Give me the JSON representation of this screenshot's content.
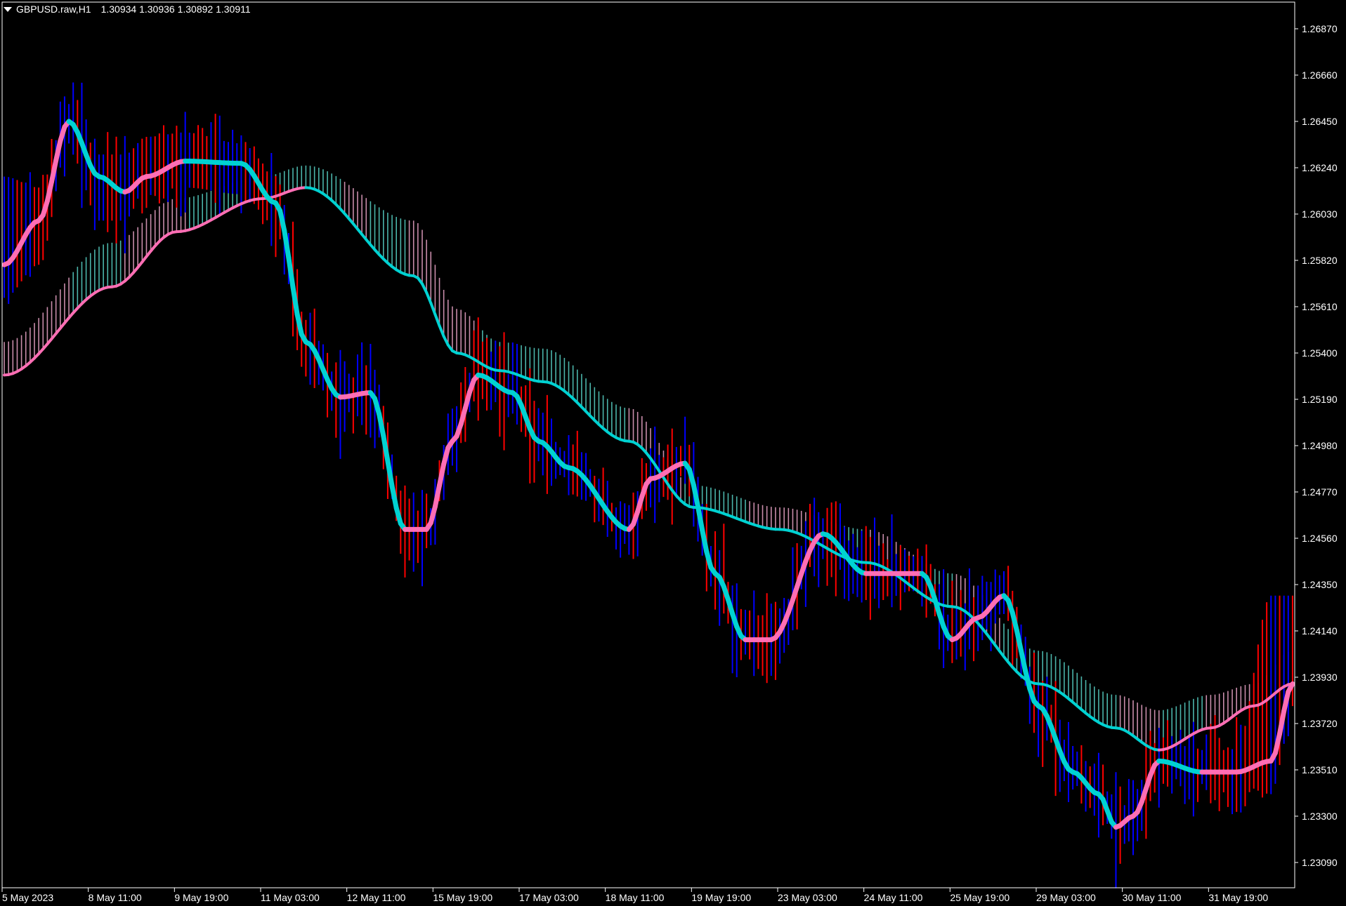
{
  "header": {
    "symbol": "GBPUSD.raw,H1",
    "quotes": "1.30934 1.30936 1.30892 1.30911"
  },
  "colors": {
    "background": "#000000",
    "axis": "#ffffff",
    "bull_candle": "#0000ff",
    "bear_candle": "#ff0000",
    "ma_down": "#00d2d2",
    "ma_up": "#ff6eb4",
    "band_down": "#4bb4aa",
    "band_up": "#c88caa"
  },
  "chart_data": {
    "type": "line",
    "title": "GBPUSD.raw,H1",
    "y_ticks": [
      "1.26870",
      "1.26660",
      "1.26450",
      "1.26240",
      "1.26030",
      "1.25820",
      "1.25610",
      "1.25400",
      "1.25190",
      "1.24980",
      "1.24770",
      "1.24560",
      "1.24350",
      "1.24140",
      "1.23930",
      "1.23720",
      "1.23510",
      "1.23300",
      "1.23090"
    ],
    "ylim": [
      1.2301,
      1.2696
    ],
    "x_ticks": [
      "5 May 2023",
      "8 May 11:00",
      "9 May 19:00",
      "11 May 03:00",
      "12 May 11:00",
      "15 May 19:00",
      "17 May 03:00",
      "18 May 11:00",
      "19 May 19:00",
      "23 May 03:00",
      "24 May 11:00",
      "25 May 19:00",
      "29 May 03:00",
      "30 May 11:00",
      "31 May 19:00"
    ],
    "bar_count": 300,
    "grid": false,
    "series": [
      {
        "kind": "fast_ma",
        "x": [
          0,
          8,
          15,
          22,
          28,
          33,
          42,
          55,
          63,
          70,
          78,
          85,
          93,
          98,
          104,
          110,
          118,
          124,
          131,
          145,
          150,
          158,
          165,
          172,
          178,
          190,
          200,
          213,
          220,
          226,
          232,
          240,
          248,
          254,
          258,
          262,
          268,
          278,
          286,
          294,
          299
        ],
        "values": [
          1.258,
          1.26,
          1.2645,
          1.262,
          1.2613,
          1.262,
          1.2627,
          1.2626,
          1.2608,
          1.2545,
          1.252,
          1.2522,
          1.246,
          1.246,
          1.25,
          1.253,
          1.2522,
          1.25,
          1.2488,
          1.246,
          1.2483,
          1.249,
          1.244,
          1.241,
          1.241,
          1.2458,
          1.244,
          1.244,
          1.241,
          1.242,
          1.243,
          1.238,
          1.235,
          1.234,
          1.2325,
          1.233,
          1.2355,
          1.235,
          1.235,
          1.2355,
          1.239
        ],
        "values_upper": [
          1.262,
          1.2615,
          1.2645,
          1.263,
          1.263,
          1.2638,
          1.264,
          1.2635,
          1.262,
          1.2555,
          1.2525,
          1.2535,
          1.2475,
          1.2465,
          1.251,
          1.2535,
          1.253,
          1.251,
          1.2493,
          1.2465,
          1.249,
          1.2495,
          1.245,
          1.2415,
          1.2415,
          1.2465,
          1.2445,
          1.2445,
          1.242,
          1.243,
          1.244,
          1.239,
          1.236,
          1.235,
          1.233,
          1.234,
          1.2365,
          1.236,
          1.236,
          1.243,
          1.243
        ],
        "values_low": [
          1.2565,
          1.258,
          1.2635,
          1.26,
          1.26,
          1.2618,
          1.2615,
          1.2612,
          1.2598,
          1.253,
          1.2516,
          1.2522,
          1.2455,
          1.2455,
          1.2497,
          1.2525,
          1.2515,
          1.2495,
          1.2483,
          1.2455,
          1.247,
          1.2485,
          1.2433,
          1.2405,
          1.2405,
          1.245,
          1.2432,
          1.2432,
          1.2405,
          1.2415,
          1.2425,
          1.2375,
          1.2345,
          1.233,
          1.2323,
          1.2325,
          1.235,
          1.2345,
          1.2345,
          1.234,
          1.2385
        ]
      },
      {
        "kind": "slow_ma",
        "x": [
          0,
          25,
          40,
          60,
          70,
          95,
          105,
          115,
          125,
          145,
          160,
          180,
          200,
          220,
          240,
          258,
          268,
          280,
          290,
          299
        ],
        "values": [
          1.253,
          1.257,
          1.2595,
          1.261,
          1.2615,
          1.2575,
          1.254,
          1.2532,
          1.2527,
          1.25,
          1.247,
          1.246,
          1.2445,
          1.2425,
          1.239,
          1.237,
          1.236,
          1.237,
          1.238,
          1.239
        ],
        "values_upper": [
          1.2545,
          1.259,
          1.261,
          1.262,
          1.2625,
          1.26,
          1.256,
          1.2545,
          1.2542,
          1.2515,
          1.248,
          1.247,
          1.246,
          1.244,
          1.2405,
          1.2385,
          1.2378,
          1.2385,
          1.239,
          1.2405
        ]
      }
    ]
  }
}
